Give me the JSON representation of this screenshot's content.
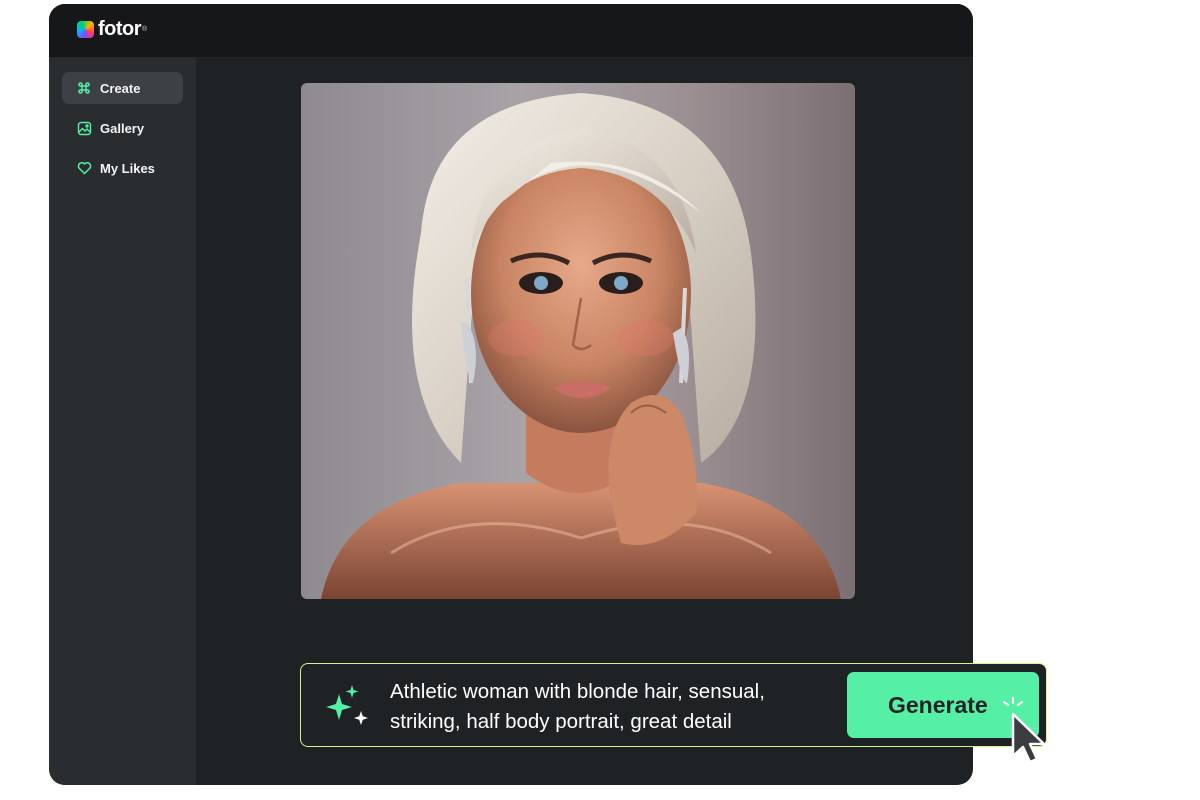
{
  "brand": {
    "name": "fotor",
    "registered_mark": "®"
  },
  "sidebar": {
    "items": [
      {
        "label": "Create",
        "icon": "command-icon",
        "active": true
      },
      {
        "label": "Gallery",
        "icon": "image-icon",
        "active": false
      },
      {
        "label": "My Likes",
        "icon": "heart-icon",
        "active": false
      }
    ]
  },
  "prompt": {
    "text": "Athletic woman with blonde hair, sensual, striking, half body portrait, great detail",
    "generate_label": "Generate",
    "icon": "sparkles-icon"
  },
  "colors": {
    "accent": "#55f0a6",
    "prompt_border": "#d7f28a",
    "app_bg": "#1f2224",
    "sidebar_bg": "#2a2d30"
  }
}
